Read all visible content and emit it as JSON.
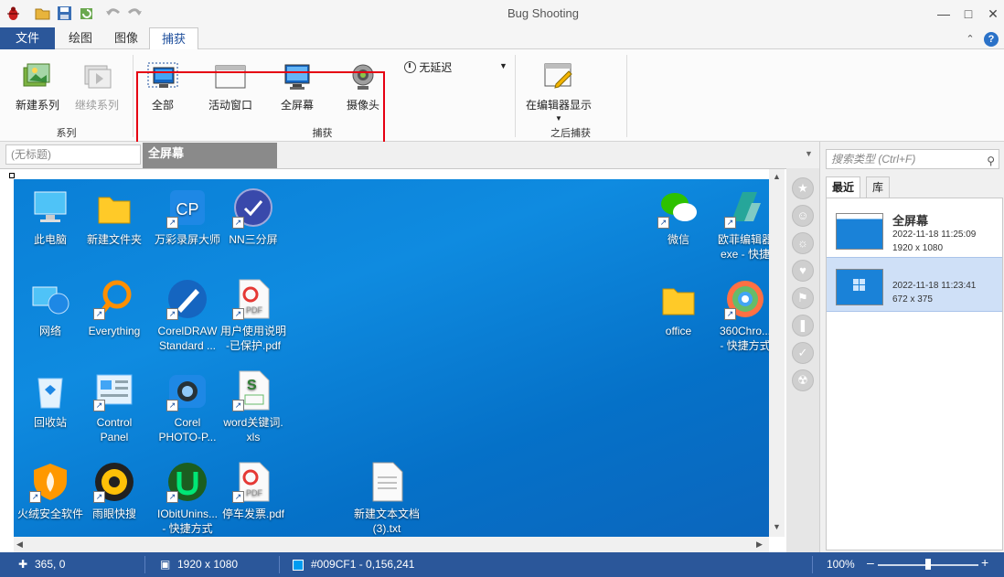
{
  "app": {
    "title": "Bug Shooting",
    "quick_access": [
      "bug-app-icon",
      "open-folder-icon",
      "save-icon",
      "refresh-icon",
      "undo-icon",
      "redo-icon"
    ],
    "window_controls": [
      "minimize",
      "maximize",
      "close"
    ]
  },
  "ribbon": {
    "tabs": [
      {
        "label": "文件"
      },
      {
        "label": "绘图"
      },
      {
        "label": "图像"
      },
      {
        "label": "捕获",
        "active": true
      }
    ],
    "series_group": {
      "label": "系列",
      "new_series": "新建系列",
      "continue_series": "继续系列"
    },
    "capture_group": {
      "label": "捕获",
      "all": "全部",
      "active_window": "活动窗口",
      "full_screen": "全屏幕",
      "camera": "摄像头",
      "delay": "无延迟"
    },
    "after_group": {
      "label": "之后捕获",
      "show_in_editor": "在编辑器显示"
    }
  },
  "document": {
    "untitled_placeholder": "(无标题)",
    "active_tab": "全屏幕"
  },
  "desktop_icons": [
    {
      "label": "此电脑",
      "icon": "computer-icon"
    },
    {
      "label": "新建文件夹",
      "icon": "folder-icon"
    },
    {
      "label": "万彩录屏大师",
      "icon": "screen-recorder-icon"
    },
    {
      "label": "NN三分屏",
      "icon": "nn-icon"
    },
    {
      "label": "微信",
      "icon": "wechat-icon"
    },
    {
      "label": "欧菲编辑器",
      "label2": "exe - 快捷",
      "icon": "editor-icon"
    },
    {
      "label": "网络",
      "icon": "network-icon"
    },
    {
      "label": "Everything",
      "icon": "magnifier-icon"
    },
    {
      "label": "CorelDRAW",
      "label2": "Standard ...",
      "icon": "coreldraw-icon"
    },
    {
      "label": "用户使用说明",
      "label2": "-已保护.pdf",
      "icon": "pdf-icon"
    },
    {
      "label": "office",
      "icon": "folder-icon"
    },
    {
      "label": "360Chro...",
      "label2": "- 快捷方式",
      "icon": "browser-icon"
    },
    {
      "label": "回收站",
      "icon": "recycle-bin-icon"
    },
    {
      "label": "Control",
      "label2": "Panel",
      "icon": "control-panel-icon"
    },
    {
      "label": "Corel",
      "label2": "PHOTO-P...",
      "icon": "camera-icon"
    },
    {
      "label": "word关键词.",
      "label2": "xls",
      "icon": "spreadsheet-icon"
    },
    {
      "label": "火绒安全软件",
      "icon": "shield-icon"
    },
    {
      "label": "雨眼快搜",
      "icon": "eye-icon"
    },
    {
      "label": "IObitUnins...",
      "label2": "- 快捷方式",
      "icon": "uninstaller-icon"
    },
    {
      "label": "停车发票.pdf",
      "icon": "pdf-icon"
    },
    {
      "label": "新建文本文档",
      "label2": "(3).txt",
      "icon": "text-file-icon"
    }
  ],
  "library": {
    "search_placeholder": "搜索类型 (Ctrl+F)",
    "tabs": [
      {
        "label": "最近",
        "active": true
      },
      {
        "label": "库"
      }
    ],
    "items": [
      {
        "title": "全屏幕",
        "date": "2022-11-18 11:25:09",
        "size": "1920 x 1080"
      },
      {
        "title": "",
        "date": "2022-11-18 11:23:41",
        "size": "672 x 375",
        "selected": true
      }
    ]
  },
  "status": {
    "cursor": "365, 0",
    "dimensions": "1920 x 1080",
    "color": "#009CF1 - 0,156,241",
    "color_swatch": "#009CF1",
    "zoom": "100%",
    "zoom_fraction": 0.5
  },
  "colors": {
    "accent": "#2b579a",
    "highlight": "#e60012",
    "desktop": "#0a7fd6"
  }
}
